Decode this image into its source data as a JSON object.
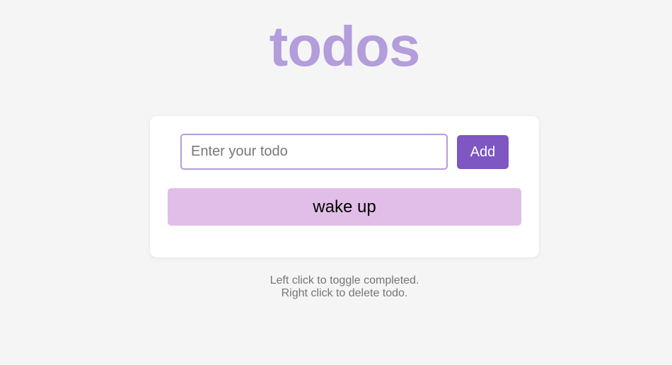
{
  "header": {
    "title": "todos"
  },
  "form": {
    "input_value": "",
    "input_placeholder": "Enter your todo",
    "add_label": "Add"
  },
  "todos": [
    {
      "text": "wake up",
      "completed": false
    }
  ],
  "help": {
    "line1": "Left click to toggle completed.",
    "line2": "Right click to delete todo."
  },
  "colors": {
    "title": "#b39ddb",
    "accent": "#7e57c2",
    "item_background": "#e1bee7",
    "input_border": "#b39ddb",
    "page_background": "#f5f5f5"
  }
}
